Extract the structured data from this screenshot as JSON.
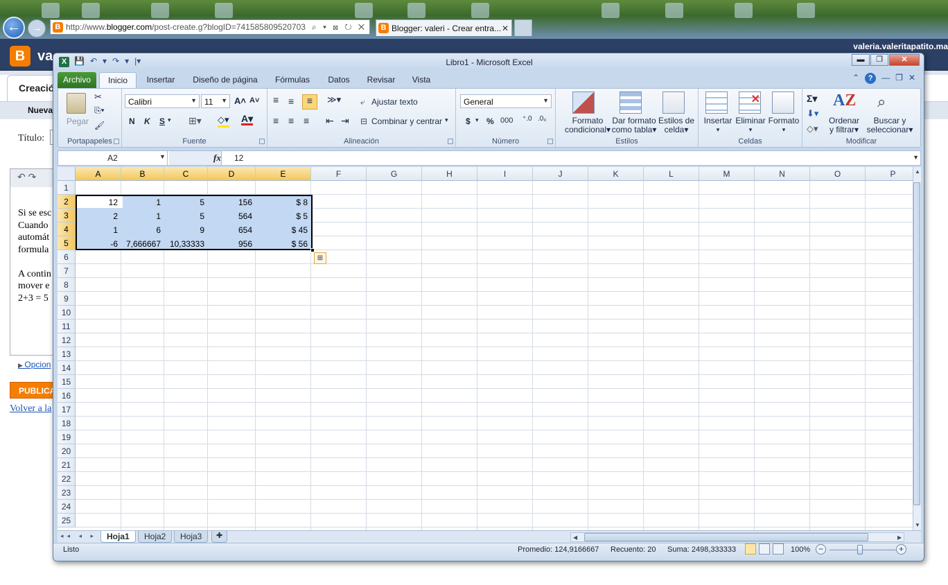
{
  "browser": {
    "url_prefix": "http://www.",
    "url_domain": "blogger.com",
    "url_rest": "/post-create.g?blogID=741585809520703",
    "url_icons": "⌕ ▾ ⊠ ↻ ✕",
    "tab_title": "Blogger: valeri - Crear entra...",
    "tab_close": "✕",
    "back": "←",
    "forward": "→",
    "favicon": "B"
  },
  "blogger": {
    "logo": "B",
    "blog_name": "va",
    "user": "valeria.valeritapatito.ma",
    "tab_create": "Creació",
    "sub_new": "Nueva",
    "title_label": "Título:",
    "editor_toolbar": "↶ ↷",
    "editor_lines": [
      "Si se esc",
      "Cuando",
      "automát",
      "formula",
      "",
      "A contin",
      "mover e",
      "2+3 = 5"
    ],
    "options_link": "Opcion",
    "publish_button": "PUBLICA",
    "back_link": "Volver a la"
  },
  "excel": {
    "app_logo": "X",
    "window_title": "Libro1  -  Microsoft Excel",
    "qat": [
      "💾",
      "↶",
      "▾",
      "↷",
      "▾",
      "|▾"
    ],
    "window_buttons": {
      "minimize": "▬",
      "maximize": "❐",
      "close": "✕"
    },
    "help_icons": [
      "⌃",
      "?",
      "—",
      "❐",
      "✕"
    ],
    "tabs": [
      "Archivo",
      "Inicio",
      "Insertar",
      "Diseño de página",
      "Fórmulas",
      "Datos",
      "Revisar",
      "Vista"
    ],
    "ribbon": {
      "clipboard": {
        "label": "Portapapeles",
        "paste": "Pegar"
      },
      "font": {
        "label": "Fuente",
        "name": "Calibri",
        "size": "11",
        "bold": "N",
        "italic": "K",
        "underline": "S"
      },
      "alignment": {
        "label": "Alineación",
        "wrap": "Ajustar texto",
        "merge": "Combinar y centrar"
      },
      "number": {
        "label": "Número",
        "format": "General",
        "currency": "$",
        "percent": "%",
        "thousands": "000"
      },
      "styles": {
        "label": "Estilos",
        "conditional": [
          "Formato",
          "condicional"
        ],
        "table": [
          "Dar formato",
          "como tabla"
        ],
        "cell": [
          "Estilos de",
          "celda"
        ]
      },
      "cells": {
        "label": "Celdas",
        "insert": "Insertar",
        "delete": "Eliminar",
        "format": "Formato"
      },
      "editing": {
        "label": "Modificar",
        "sort": [
          "Ordenar",
          "y filtrar"
        ],
        "find": [
          "Buscar y",
          "seleccionar"
        ]
      }
    },
    "formula_bar": {
      "name_box": "A2",
      "fx": "fx",
      "value": "12"
    },
    "columns": [
      "A",
      "B",
      "C",
      "D",
      "E",
      "F",
      "G",
      "H",
      "I",
      "J",
      "K",
      "L",
      "M",
      "N",
      "O",
      "P"
    ],
    "rows": [
      "1",
      "2",
      "3",
      "4",
      "5",
      "6",
      "7",
      "8",
      "9",
      "10",
      "11",
      "12",
      "13",
      "14",
      "15",
      "16",
      "17",
      "18",
      "19",
      "20",
      "21",
      "22",
      "23",
      "24",
      "25"
    ],
    "cells": [
      [
        "12",
        "1",
        "5",
        "156",
        "$ 8"
      ],
      [
        "2",
        "1",
        "5",
        "564",
        "$ 5"
      ],
      [
        "1",
        "6",
        "9",
        "654",
        "$ 45"
      ],
      [
        "-6",
        "7,666667",
        "10,33333",
        "956",
        "$ 56"
      ]
    ],
    "sheet_tabs": [
      "Hoja1",
      "Hoja2",
      "Hoja3"
    ],
    "sheet_nav": "◂◂ ◂ ▸ ▸▸",
    "status": {
      "ready": "Listo",
      "average": "Promedio: 124,9166667",
      "count": "Recuento: 20",
      "sum": "Suma: 2498,333333",
      "zoom": "100%"
    },
    "colors": {
      "selection": "#c3d8f2",
      "header_selected": "#f4c75b",
      "archivo_tab": "#2c7423"
    }
  }
}
